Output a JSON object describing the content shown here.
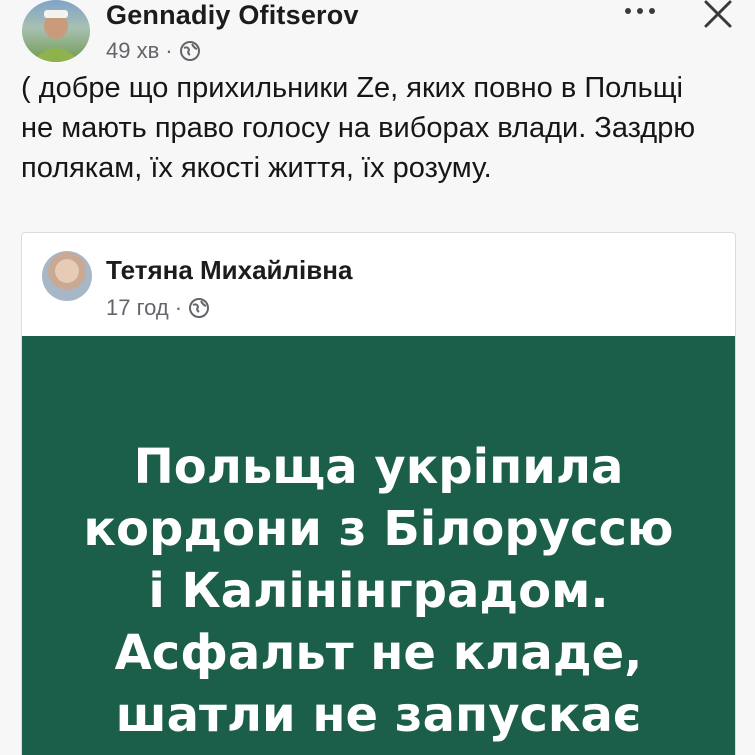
{
  "post": {
    "author": "Gennadiy Ofitserov",
    "time": "49 хв",
    "separator": "·",
    "text": "( добре що прихильники Ze, яких повно в Польщі не мають право голосу на виборах влади. Заздрю полякам, їх якості життя, їх розуму."
  },
  "shared": {
    "author": "Тетяна Михайлівна",
    "time": "17 год",
    "separator": "·",
    "lines": [
      "Польща укріпила",
      "кордони з Білоруссю",
      "і Калінінградом.",
      "Асфальт не кладе,",
      "шатли не запускає"
    ]
  },
  "icons": {
    "more": "more-horizontal-icon",
    "close": "close-icon",
    "privacy": "globe-icon"
  },
  "colors": {
    "banner_bg": "#1b5e49",
    "page_bg": "#f7f7f7"
  }
}
